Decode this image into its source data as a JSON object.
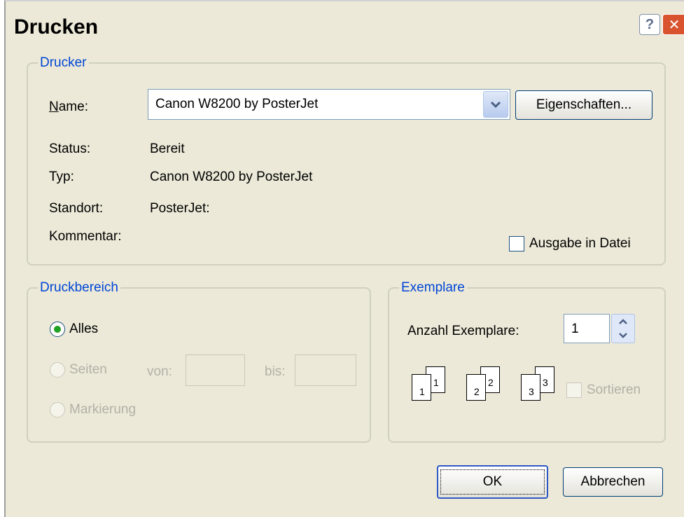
{
  "window": {
    "title": "Drucken",
    "help_label": "?",
    "close_label": "✕"
  },
  "printer": {
    "legend": "Drucker",
    "name_label": "Name:",
    "name_value": "Canon W8200 by PosterJet",
    "properties_button": "Eigenschaften...",
    "status_label": "Status:",
    "status_value": "Bereit",
    "type_label": "Typ:",
    "type_value": "Canon W8200 by PosterJet",
    "location_label": "Standort:",
    "location_value": "PosterJet:",
    "comment_label": "Kommentar:",
    "print_to_file_label": "Ausgabe in Datei"
  },
  "range": {
    "legend": "Druckbereich",
    "all_label": "Alles",
    "pages_label": "Seiten",
    "from_label": "von:",
    "to_label": "bis:",
    "selection_label": "Markierung"
  },
  "copies": {
    "legend": "Exemplare",
    "count_label": "Anzahl Exemplare:",
    "count_value": "1",
    "collate_label": "Sortieren",
    "page_numbers": [
      "1",
      "1",
      "2",
      "2",
      "3",
      "3"
    ]
  },
  "buttons": {
    "ok": "OK",
    "cancel": "Abbrechen"
  }
}
